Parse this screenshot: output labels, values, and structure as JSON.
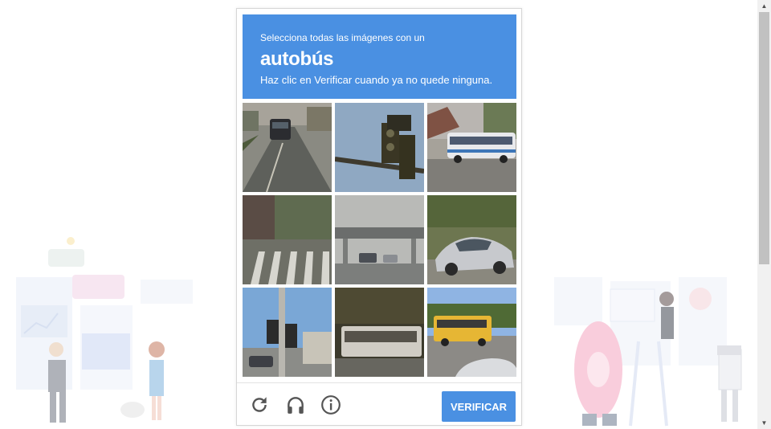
{
  "challenge": {
    "instruction_line1": "Selecciona todas las imágenes con un",
    "target_object": "autobús",
    "instruction_line3": "Haz clic en Verificar cuando ya no quede ninguna.",
    "header_color": "#4a90e2"
  },
  "tiles": [
    {
      "scene": "street with dark car"
    },
    {
      "scene": "traffic light against sky"
    },
    {
      "scene": "white bus on street"
    },
    {
      "scene": "crosswalk"
    },
    {
      "scene": "highway overpass"
    },
    {
      "scene": "silver sedan"
    },
    {
      "scene": "traffic signal pole"
    },
    {
      "scene": "bus in shade"
    },
    {
      "scene": "yellow school bus"
    }
  ],
  "footer": {
    "reload_icon": "reload-icon",
    "audio_icon": "headphones-icon",
    "info_icon": "info-icon",
    "verify_label": "VERIFICAR"
  }
}
